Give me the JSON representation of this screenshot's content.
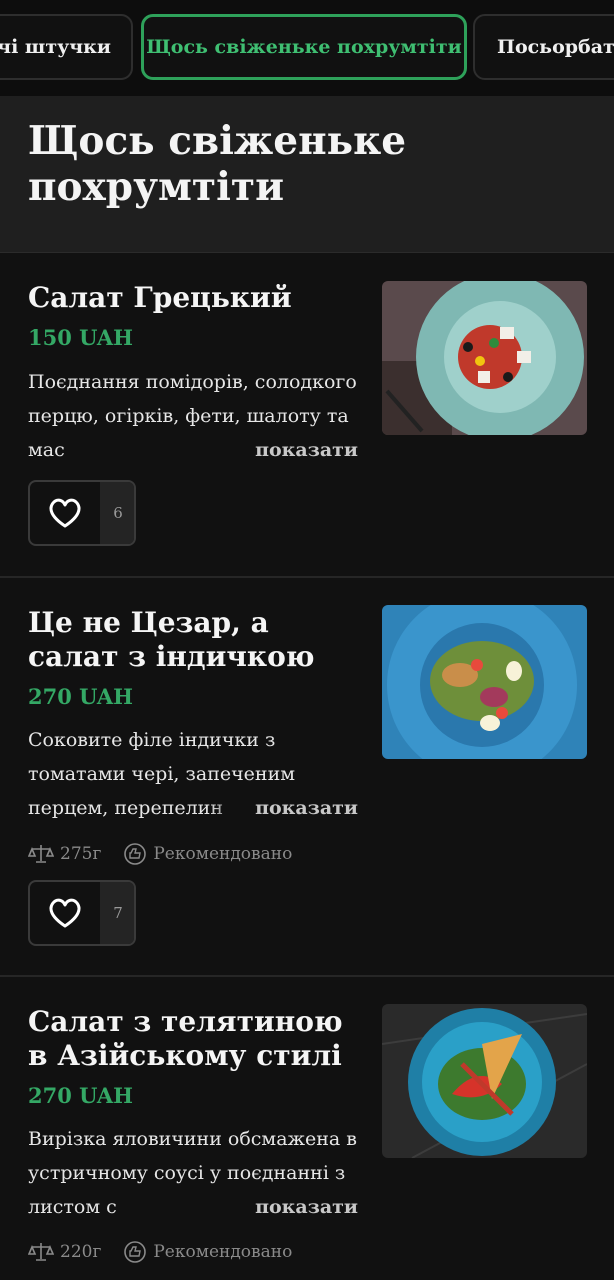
{
  "tabs": [
    {
      "label": "ячі штучки"
    },
    {
      "label": "Щось свіженьке похрумтіти"
    },
    {
      "label": "Посьорбати"
    }
  ],
  "section": {
    "title": "Щось свіженьке похрумтіти"
  },
  "show_more_label": "показати",
  "items": [
    {
      "title": "Салат Грецький",
      "price": "150 UAH",
      "description": "Поєднання помідорів, солодкого перцю, огірків, фети, шалоту та мас",
      "likes": "6"
    },
    {
      "title": "Це не Цезар, а салат з індичкою",
      "price": "270 UAH",
      "description": "Соковите філе індички з томатами чері, запеченим перцем, перепелин",
      "weight": "275г",
      "badge": "Рекомендовано",
      "likes": "7"
    },
    {
      "title": "Салат з телятиною в Азійському стилі",
      "price": "270 UAH",
      "description": "Вирізка яловичини обсмажена в устричному соусі у поєднанні з листом с",
      "weight": "220г",
      "badge": "Рекомендовано"
    }
  ],
  "colors": {
    "accent": "#34a865",
    "background": "#111111"
  }
}
